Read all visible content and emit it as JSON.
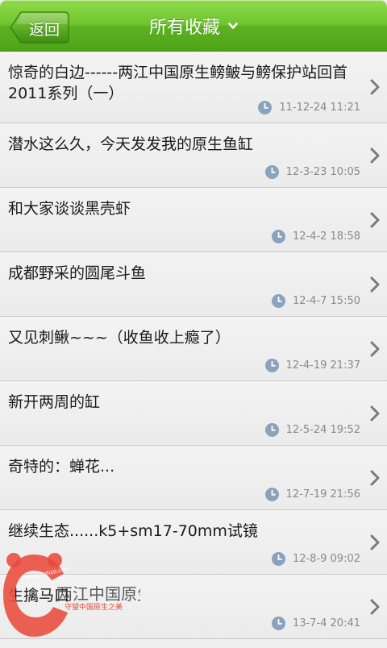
{
  "header": {
    "back_label": "返回",
    "title": "所有收藏"
  },
  "items": [
    {
      "title": "惊奇的白边------两江中国原生鳑鲏与鳑保护站回首2011系列（一）",
      "time": "11-12-24 11:21"
    },
    {
      "title": "潜水这么久，今天发发我的原生鱼缸",
      "time": "12-3-23 10:05"
    },
    {
      "title": "和大家谈谈黑壳虾",
      "time": "12-4-2 18:58"
    },
    {
      "title": "成都野采的圆尾斗鱼",
      "time": "12-4-7 15:50"
    },
    {
      "title": "又见刺鳅~~~（收鱼收上瘾了）",
      "time": "12-4-19 21:37"
    },
    {
      "title": "新开两周的缸",
      "time": "12-5-24 19:52"
    },
    {
      "title": "奇特的：蝉花...",
      "time": "12-7-19 21:56"
    },
    {
      "title": "继续生态......k5+sm17-70mm试镜",
      "time": "12-8-9 09:02"
    },
    {
      "title": "生擒马口",
      "time": "13-7-4 20:41"
    }
  ],
  "watermark": {
    "url": "www.cghzo.com",
    "brand": "两江中国原生",
    "slogan": "守望中国原生之美"
  },
  "colors": {
    "header_green": "#5cb321",
    "row_bg": "#efefef",
    "time_gray": "#8a8a8a",
    "watermark_red": "#e94b3c"
  }
}
